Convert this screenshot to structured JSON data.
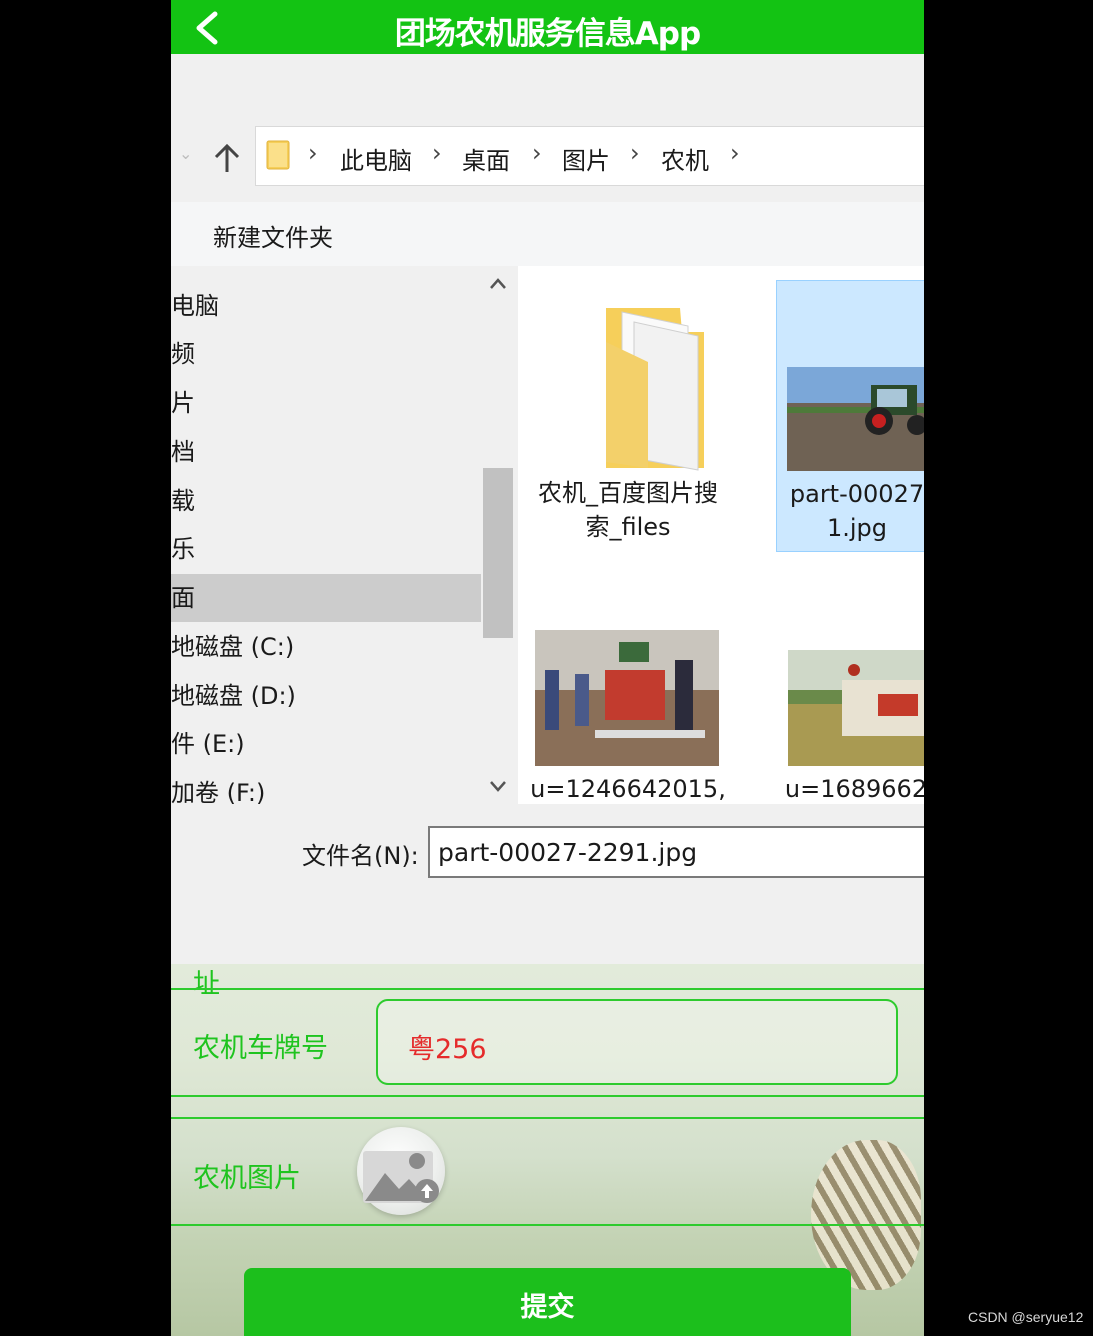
{
  "app": {
    "title": "团场农机服务信息App"
  },
  "dialog": {
    "breadcrumb": [
      "此电脑",
      "桌面",
      "图片",
      "农机"
    ],
    "new_folder_label": "新建文件夹",
    "nav_items": [
      {
        "label": "电脑",
        "selected": false
      },
      {
        "label": "频",
        "selected": false
      },
      {
        "label": "片",
        "selected": false
      },
      {
        "label": "档",
        "selected": false
      },
      {
        "label": "载",
        "selected": false
      },
      {
        "label": "乐",
        "selected": false
      },
      {
        "label": "面",
        "selected": true
      },
      {
        "label": "地磁盘 (C:)",
        "selected": false
      },
      {
        "label": "地磁盘 (D:)",
        "selected": false
      },
      {
        "label": "件 (E:)",
        "selected": false
      },
      {
        "label": "加卷 (F:)",
        "selected": false
      }
    ],
    "files": [
      {
        "name_line1": "农机_百度图片搜",
        "name_line2": "索_files",
        "type": "folder"
      },
      {
        "name_line1": "part-00027",
        "name_line2": "1.jpg",
        "type": "image",
        "selected": true
      },
      {
        "name_line1": "u=1246642015,",
        "name_line2": "",
        "type": "image"
      },
      {
        "name_line1": "u=1689662",
        "name_line2": "",
        "type": "image"
      }
    ],
    "filename_label": "文件名(N):",
    "filename_value": "part-00027-2291.jpg"
  },
  "form": {
    "partial_label": "址",
    "plate_label": "农机车牌号",
    "plate_value": "粤256",
    "image_label": "农机图片",
    "submit_label": "提交"
  },
  "watermark": "CSDN @seryue12"
}
